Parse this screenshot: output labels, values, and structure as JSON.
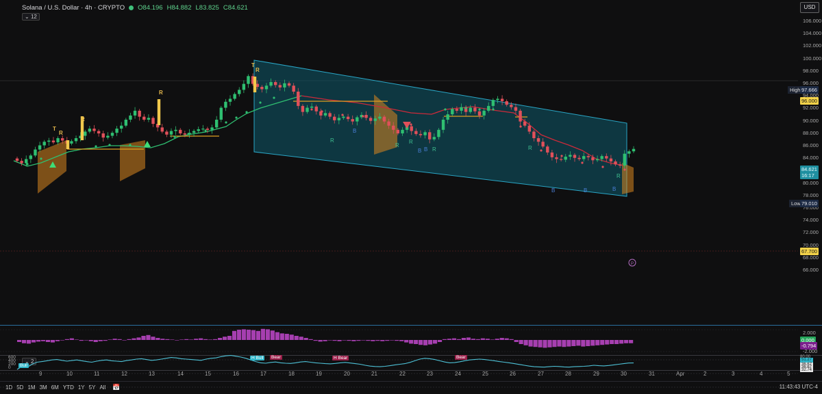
{
  "header": {
    "symbol": "Solana / U.S. Dollar · 4h · CRYPTO",
    "open": "O84.196",
    "high": "H84.882",
    "low": "L83.825",
    "close": "C84.621",
    "indicator_count": "12",
    "currency": "USD"
  },
  "price_axis": {
    "ticks": [
      "106.000",
      "104.000",
      "102.000",
      "100.000",
      "98.000",
      "96.000",
      "94.000",
      "92.000",
      "90.000",
      "88.000",
      "86.000",
      "84.000",
      "82.000",
      "80.000",
      "78.000",
      "76.000",
      "74.000",
      "72.000",
      "70.000",
      "68.000",
      "66.000"
    ],
    "high_label": "High",
    "high_value": "97.666",
    "level_96": "96.000",
    "last_price": "84.621",
    "countdown": "16:17",
    "low_label": "Low",
    "low_value": "79.010",
    "level_67": "67.700"
  },
  "osc_axis": {
    "ticks": [
      "2.000",
      "-2.000"
    ],
    "zero": "0.000",
    "value": "-0.794"
  },
  "rsi_pane": {
    "legend_count": "2",
    "left_ticks": [
      "600",
      "400",
      "200",
      "0"
    ],
    "right_ticks": [
      "80.00",
      "60.00",
      "40.00",
      "20.00"
    ],
    "current": "51.27",
    "vals": [
      "36.67",
      "36.67",
      "32.74"
    ],
    "labels": [
      {
        "text": "H Bull",
        "color": "#2fb6c9"
      },
      {
        "text": "Bear",
        "color": "#9c1f4a"
      },
      {
        "text": "H Bear",
        "color": "#9c1f4a"
      },
      {
        "text": "Bear",
        "color": "#9c1f4a"
      },
      {
        "text": "Bull",
        "color": "#2fb6c9"
      }
    ]
  },
  "markers": {
    "t": "T",
    "r": "R",
    "b": "B"
  },
  "x_axis": [
    "9",
    "10",
    "11",
    "12",
    "13",
    "14",
    "15",
    "16",
    "17",
    "18",
    "19",
    "20",
    "21",
    "22",
    "23",
    "24",
    "25",
    "26",
    "27",
    "28",
    "29",
    "30",
    "31",
    "Apr",
    "2",
    "3",
    "4",
    "5"
  ],
  "toolbar": {
    "timeframes": [
      "1D",
      "5D",
      "1M",
      "3M",
      "6M",
      "YTD",
      "1Y",
      "5Y",
      "All"
    ],
    "clock": "11:43:43 UTC-4"
  },
  "colors": {
    "bull": "#2fbf71",
    "bear": "#e0505a",
    "channel": "#2aa7c7",
    "histogram": "#a63fb0",
    "rsi_line": "#4ec3d8"
  }
}
